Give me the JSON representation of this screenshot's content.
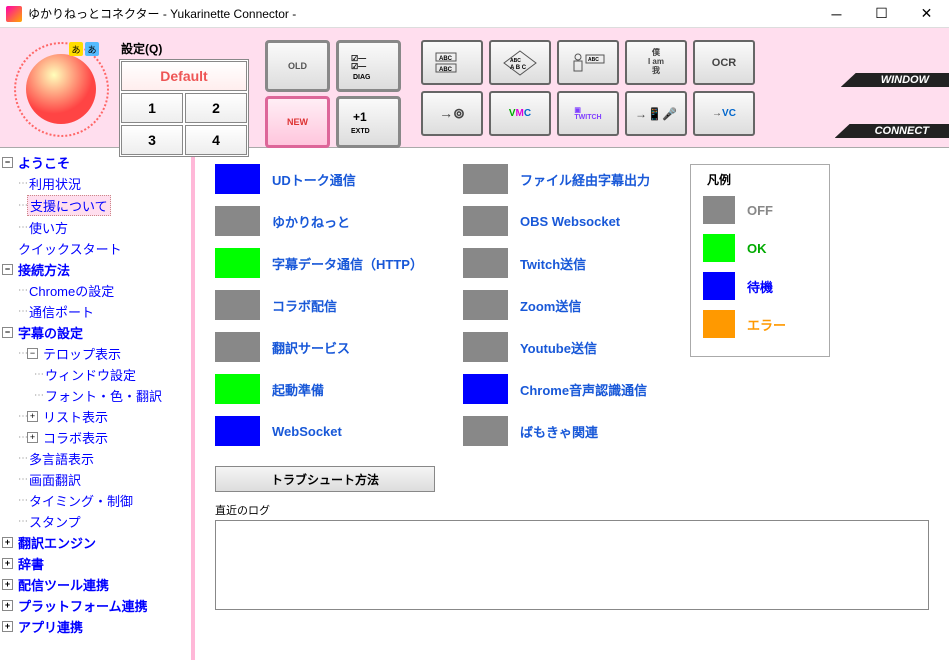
{
  "title": "ゆかりねっとコネクター  - Yukarinette Connector -",
  "settings": {
    "label": "設定(Q)",
    "default": "Default",
    "buttons": [
      "1",
      "2",
      "3",
      "4"
    ]
  },
  "bigButtons": {
    "old": "OLD",
    "new": "NEW",
    "diag": "DIAG",
    "extd": "+1\nEXTD"
  },
  "toolRows": {
    "window_label": "WINDOW",
    "connect_label": "CONNECT",
    "row1": [
      "ABC",
      "ABC",
      "👤",
      "僕 I am 我",
      "OCR"
    ],
    "row2": [
      "→⊚",
      "VMC",
      "TWITCH",
      "→🎤",
      "→VC"
    ]
  },
  "tree": [
    {
      "label": "ようこそ",
      "level": 0,
      "exp": "-",
      "bold": true
    },
    {
      "label": "利用状況",
      "level": 1
    },
    {
      "label": "支援について",
      "level": 1,
      "selected": true
    },
    {
      "label": "使い方",
      "level": 1
    },
    {
      "label": "クイックスタート",
      "level": 0,
      "exp": ""
    },
    {
      "label": "接続方法",
      "level": 0,
      "exp": "-",
      "bold": true
    },
    {
      "label": "Chromeの設定",
      "level": 1
    },
    {
      "label": "通信ポート",
      "level": 1
    },
    {
      "label": "字幕の設定",
      "level": 0,
      "exp": "-",
      "bold": true
    },
    {
      "label": "テロップ表示",
      "level": 1,
      "exp": "-"
    },
    {
      "label": "ウィンドウ設定",
      "level": 2
    },
    {
      "label": "フォント・色・翻訳",
      "level": 2
    },
    {
      "label": "リスト表示",
      "level": 1,
      "exp": "+"
    },
    {
      "label": "コラボ表示",
      "level": 1,
      "exp": "+"
    },
    {
      "label": "多言語表示",
      "level": 1
    },
    {
      "label": "画面翻訳",
      "level": 1
    },
    {
      "label": "タイミング・制御",
      "level": 1
    },
    {
      "label": "スタンプ",
      "level": 1
    },
    {
      "label": "翻訳エンジン",
      "level": 0,
      "exp": "+",
      "bold": true
    },
    {
      "label": "辞書",
      "level": 0,
      "exp": "+",
      "bold": true
    },
    {
      "label": "配信ツール連携",
      "level": 0,
      "exp": "+",
      "bold": true
    },
    {
      "label": "プラットフォーム連携",
      "level": 0,
      "exp": "+",
      "bold": true
    },
    {
      "label": "アプリ連携",
      "level": 0,
      "exp": "+",
      "bold": true
    }
  ],
  "statusLeft": [
    {
      "label": "UDトーク通信",
      "state": "wait"
    },
    {
      "label": "ゆかりねっと",
      "state": "off"
    },
    {
      "label": "字幕データ通信（HTTP）",
      "state": "ok"
    },
    {
      "label": "コラボ配信",
      "state": "off"
    },
    {
      "label": "翻訳サービス",
      "state": "off"
    },
    {
      "label": "起動準備",
      "state": "ok"
    },
    {
      "label": "WebSocket",
      "state": "wait"
    }
  ],
  "statusRight": [
    {
      "label": "ファイル経由字幕出力",
      "state": "off"
    },
    {
      "label": "OBS Websocket",
      "state": "off"
    },
    {
      "label": "Twitch送信",
      "state": "off"
    },
    {
      "label": "Zoom送信",
      "state": "off"
    },
    {
      "label": "Youtube送信",
      "state": "off"
    },
    {
      "label": "Chrome音声認識通信",
      "state": "wait"
    },
    {
      "label": "ばもきゃ関連",
      "state": "off"
    }
  ],
  "legend": {
    "title": "凡例",
    "items": [
      {
        "label": "OFF",
        "cls": "off"
      },
      {
        "label": "OK",
        "cls": "ok"
      },
      {
        "label": "待機",
        "cls": "wait"
      },
      {
        "label": "エラー",
        "cls": "err"
      }
    ]
  },
  "troubleshoot": "トラブシュート方法",
  "log": {
    "label": "直近のログ"
  }
}
